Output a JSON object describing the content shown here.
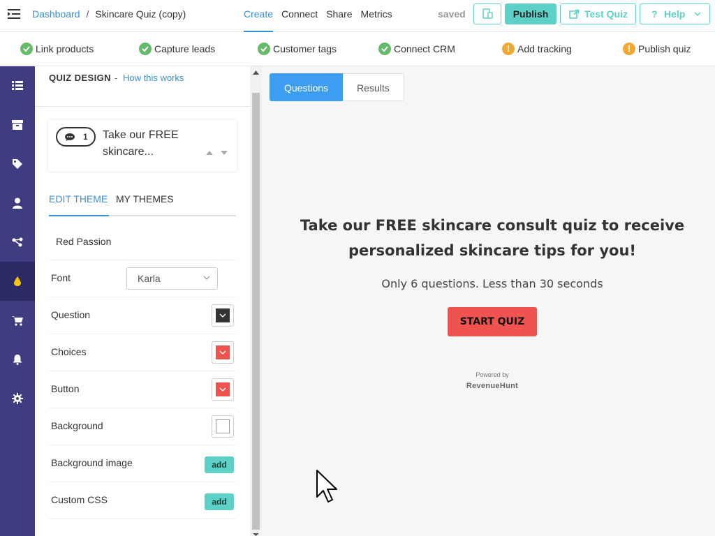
{
  "header": {
    "breadcrumb_root": "Dashboard",
    "breadcrumb_sep": "/",
    "breadcrumb_current": "Skincare Quiz (copy)",
    "nav": [
      {
        "label": "Create",
        "active": true
      },
      {
        "label": "Connect"
      },
      {
        "label": "Share"
      },
      {
        "label": "Metrics"
      }
    ],
    "status": "saved",
    "publish_label": "Publish",
    "test_label": "Test Quiz",
    "help_label": "Help"
  },
  "steps": [
    {
      "label": "Link products",
      "status": "done"
    },
    {
      "label": "Capture leads",
      "status": "done"
    },
    {
      "label": "Customer tags",
      "status": "done"
    },
    {
      "label": "Connect CRM",
      "status": "done"
    },
    {
      "label": "Add tracking",
      "status": "warning"
    },
    {
      "label": "Publish quiz",
      "status": "warning"
    }
  ],
  "rail": {
    "icons": [
      "list-icon",
      "box-icon",
      "tag-icon",
      "user-icon",
      "share-icon",
      "drop-icon",
      "cart-icon",
      "bell-icon",
      "gear-icon"
    ],
    "active": "drop-icon"
  },
  "panel": {
    "title": "QUIZ DESIGN",
    "dash": "-",
    "help_link": "How this works",
    "question": {
      "count": "1",
      "text": "Take our FREE skincare..."
    },
    "tabs": [
      "EDIT THEME",
      "MY THEMES"
    ],
    "theme_name": "Red Passion",
    "font_label": "Font",
    "font_value": "Karla",
    "rows": {
      "question": "Question",
      "choices": "Choices",
      "button": "Button",
      "background": "Background",
      "background_image": "Background image",
      "custom_css": "Custom CSS"
    },
    "add_label": "add",
    "colors": {
      "question": "#333333",
      "choices": "#ef5350",
      "button": "#ef5350",
      "background": "#ffffff"
    }
  },
  "preview": {
    "tabs": [
      "Questions",
      "Results"
    ],
    "headline_line1": "Take our FREE skincare consult quiz to receive",
    "headline_line2": "personalized skincare tips for you!",
    "subtitle": "Only 6 questions. Less than 30 seconds",
    "start_label": "START QUIZ",
    "powered_by": "Powered by",
    "brand": "RevenueHunt"
  },
  "colors": {
    "accent": "#3a8fd6",
    "teal": "#5ed1c7",
    "rail": "#3f3d82",
    "ok": "#66bb6a",
    "warn": "#f0a832"
  }
}
